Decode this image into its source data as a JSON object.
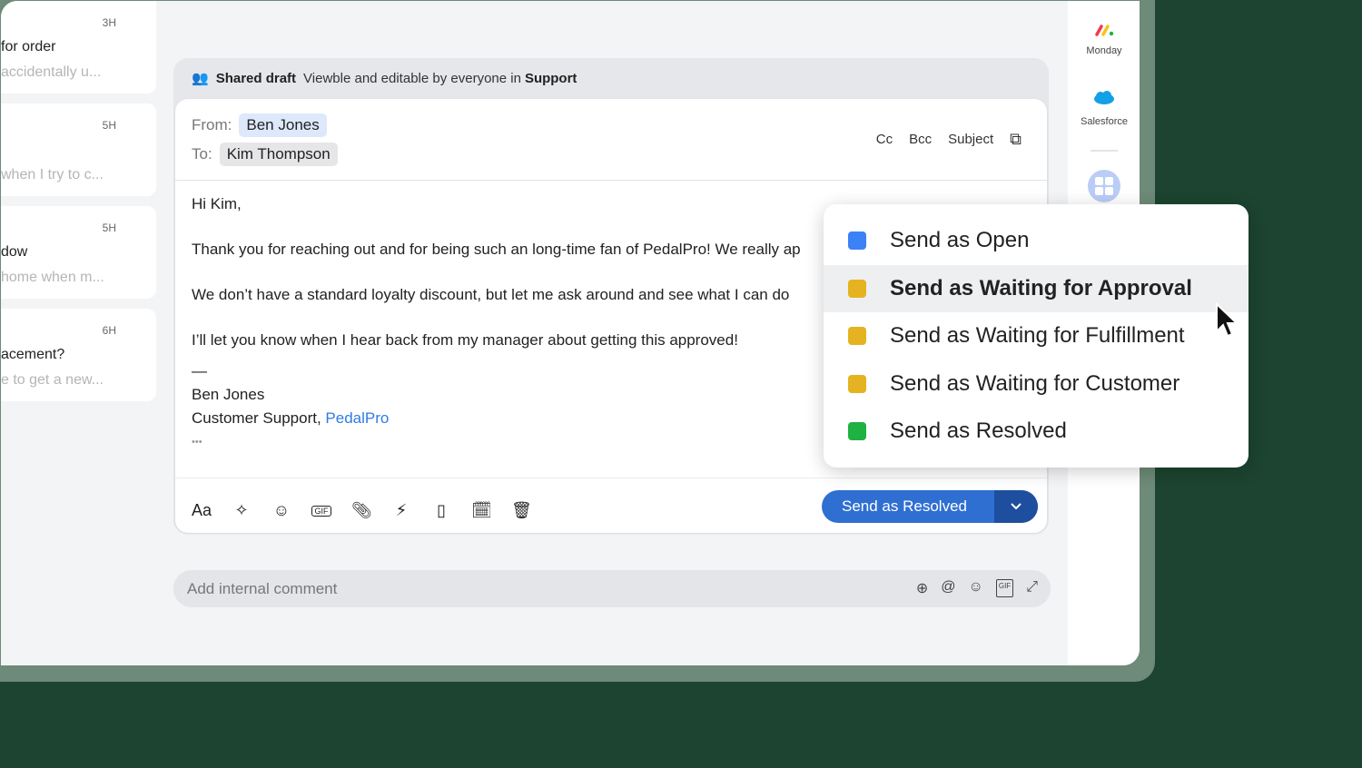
{
  "list": [
    {
      "time": "3H",
      "subject": "for order",
      "preview": "accidentally u..."
    },
    {
      "time": "5H",
      "subject": "",
      "preview": "when I try to c..."
    },
    {
      "time": "5H",
      "subject": "dow",
      "preview": "home when m..."
    },
    {
      "time": "6H",
      "subject": "acement?",
      "preview": "e to get a new..."
    }
  ],
  "draft": {
    "title": "Shared draft",
    "desc": "Viewble and editable by everyone in",
    "team": "Support"
  },
  "composer": {
    "from_label": "From:",
    "from": "Ben Jones",
    "to_label": "To:",
    "to": "Kim Thompson",
    "cc": "Cc",
    "bcc": "Bcc",
    "subject": "Subject",
    "body": [
      "Hi Kim,",
      "Thank you for reaching out and for being such an long-time fan of PedalPro! We really ap",
      "We don’t have a standard loyalty discount, but let me ask around and see what I can do",
      "I’ll let you know when I hear back from my manager about getting this approved!"
    ],
    "dash": "—",
    "sig_name": "Ben Jones",
    "sig_role": "Customer Support, ",
    "sig_link": "PedalPro",
    "more": "•••",
    "font_btn": "Aa",
    "send": "Send as Resolved"
  },
  "comment": {
    "placeholder": "Add internal comment"
  },
  "sidebar": [
    {
      "label": "Monday"
    },
    {
      "label": "Salesforce"
    }
  ],
  "menu": [
    {
      "label": "Send as Open",
      "color": "#3b82f6"
    },
    {
      "label": "Send as Waiting for Approval",
      "color": "#e5b321"
    },
    {
      "label": "Send as Waiting for Fulfillment",
      "color": "#e5b321"
    },
    {
      "label": "Send as Waiting for Customer",
      "color": "#e5b321"
    },
    {
      "label": "Send as Resolved",
      "color": "#1fb141"
    }
  ],
  "colors": {
    "background": "#1c4430",
    "accent": "#2f6fd2"
  }
}
